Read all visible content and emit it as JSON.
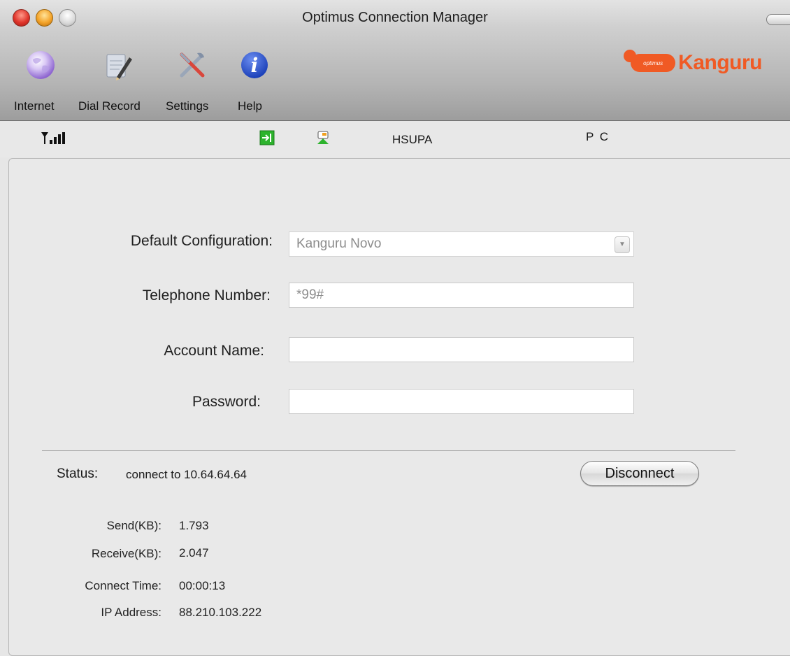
{
  "window": {
    "title": "Optimus Connection Manager"
  },
  "toolbar": {
    "items": [
      {
        "label": "Internet",
        "icon": "globe-icon"
      },
      {
        "label": "Dial Record",
        "icon": "notepad-pencil-icon"
      },
      {
        "label": "Settings",
        "icon": "tools-icon"
      },
      {
        "label": "Help",
        "icon": "info-icon"
      }
    ]
  },
  "brand": {
    "small": "optimus",
    "word": "Kanguru"
  },
  "status_strip": {
    "signal_icon": "signal-strength-icon",
    "connected_icon": "connection-arrow-icon",
    "sms_icon": "sms-icon",
    "network": "HSUPA",
    "mode": "P C"
  },
  "form": {
    "config_label": "Default Configuration:",
    "config_value": "Kanguru Novo",
    "phone_label": "Telephone Number:",
    "phone_value": "*99#",
    "account_label": "Account Name:",
    "account_value": "",
    "password_label": "Password:",
    "password_value": ""
  },
  "status": {
    "label": "Status:",
    "value": "connect to 10.64.64.64",
    "disconnect_label": "Disconnect"
  },
  "stats": {
    "send_label": "Send(KB):",
    "send_value": "1.793",
    "receive_label": "Receive(KB):",
    "receive_value": "2.047",
    "time_label": "Connect Time:",
    "time_value": "00:00:13",
    "ip_label": "IP Address:",
    "ip_value": "88.210.103.222"
  },
  "colors": {
    "brand": "#f05a24",
    "connect_green": "#2db32d"
  }
}
